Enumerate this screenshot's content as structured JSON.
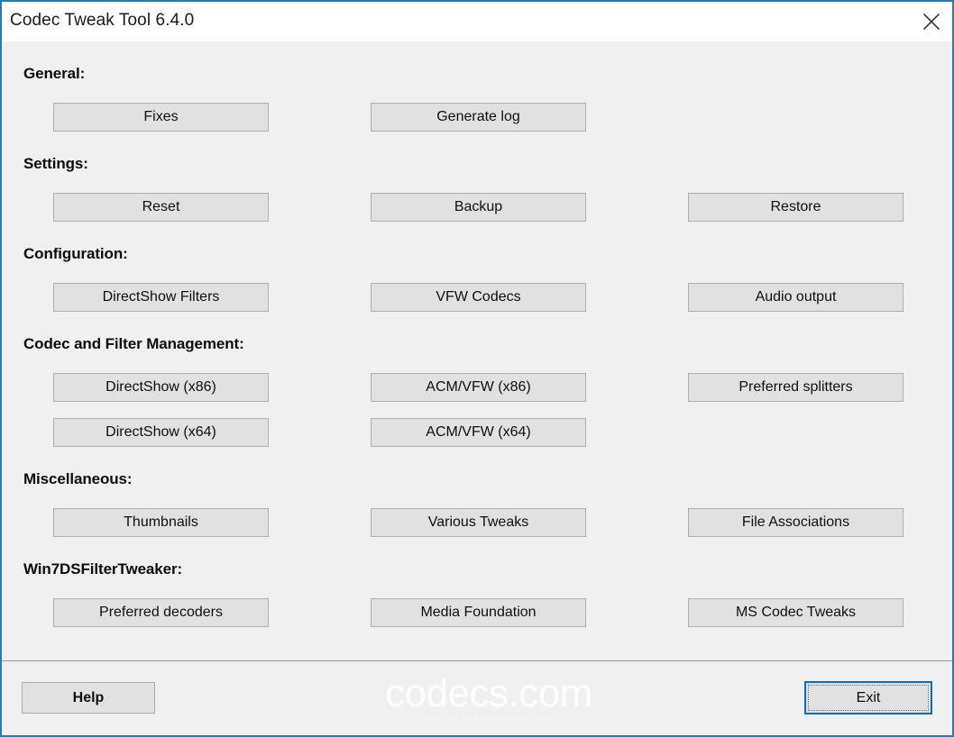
{
  "window": {
    "title": "Codec Tweak Tool 6.4.0",
    "close_icon": "close-icon",
    "border_color": "#2a7ab0",
    "titlebar_bg": "#ffffff",
    "body_bg": "#f0f0f0"
  },
  "sections": [
    {
      "label": "General:",
      "buttons": [
        {
          "label": "Fixes",
          "column": 1,
          "row": 0
        },
        {
          "label": "Generate log",
          "column": 2,
          "row": 0
        }
      ]
    },
    {
      "label": "Settings:",
      "buttons": [
        {
          "label": "Reset",
          "column": 1,
          "row": 0
        },
        {
          "label": "Backup",
          "column": 2,
          "row": 0
        },
        {
          "label": "Restore",
          "column": 3,
          "row": 0
        }
      ]
    },
    {
      "label": "Configuration:",
      "buttons": [
        {
          "label": "DirectShow Filters",
          "column": 1,
          "row": 0
        },
        {
          "label": "VFW Codecs",
          "column": 2,
          "row": 0
        },
        {
          "label": "Audio output",
          "column": 3,
          "row": 0
        }
      ]
    },
    {
      "label": "Codec and Filter Management:",
      "buttons": [
        {
          "label": "DirectShow  (x86)",
          "column": 1,
          "row": 0
        },
        {
          "label": "ACM/VFW  (x86)",
          "column": 2,
          "row": 0
        },
        {
          "label": "Preferred splitters",
          "column": 3,
          "row": 0
        },
        {
          "label": "DirectShow  (x64)",
          "column": 1,
          "row": 1
        },
        {
          "label": "ACM/VFW  (x64)",
          "column": 2,
          "row": 1
        }
      ]
    },
    {
      "label": "Miscellaneous:",
      "buttons": [
        {
          "label": "Thumbnails",
          "column": 1,
          "row": 0
        },
        {
          "label": "Various Tweaks",
          "column": 2,
          "row": 0
        },
        {
          "label": "File Associations",
          "column": 3,
          "row": 0
        }
      ]
    },
    {
      "label": "Win7DSFilterTweaker:",
      "buttons": [
        {
          "label": "Preferred decoders",
          "column": 1,
          "row": 0
        },
        {
          "label": "Media Foundation",
          "column": 2,
          "row": 0
        },
        {
          "label": "MS Codec Tweaks",
          "column": 3,
          "row": 0
        }
      ]
    }
  ],
  "footer": {
    "help_label": "Help",
    "exit_label": "Exit",
    "watermark_main": "codecs.com",
    "watermark_sub": "Download Free Multimedia Software",
    "exit_focus_color": "#0f6cbd"
  }
}
